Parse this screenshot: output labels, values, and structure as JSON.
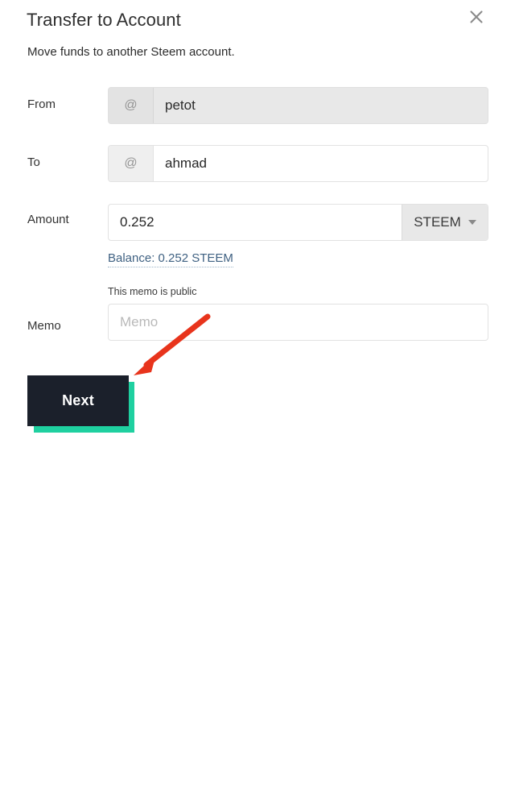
{
  "dialog": {
    "title": "Transfer to Account",
    "subtitle": "Move funds to another Steem account.",
    "close_icon": "close-icon"
  },
  "form": {
    "from": {
      "label": "From",
      "prefix": "@",
      "value": "petot",
      "placeholder": "",
      "disabled": true
    },
    "to": {
      "label": "To",
      "prefix": "@",
      "value": "ahmad",
      "placeholder": "",
      "disabled": false
    },
    "amount": {
      "label": "Amount",
      "value": "0.252",
      "placeholder": "",
      "currency": "STEEM",
      "currency_caret_icon": "chevron-down-icon"
    },
    "balance_link": "Balance: 0.252 STEEM",
    "memo": {
      "label": "Memo",
      "note": "This memo is public",
      "value": "",
      "placeholder": "Memo"
    }
  },
  "actions": {
    "next_label": "Next"
  },
  "annotation": {
    "arrow_icon": "red-arrow-pointer"
  },
  "colors": {
    "accent_teal": "#1fd0a0",
    "button_dark": "#1b202b",
    "link_blue": "#3f6182",
    "annotation_red": "#e8341c",
    "field_border": "#e2e2e2",
    "disabled_bg": "#e8e8e8"
  }
}
